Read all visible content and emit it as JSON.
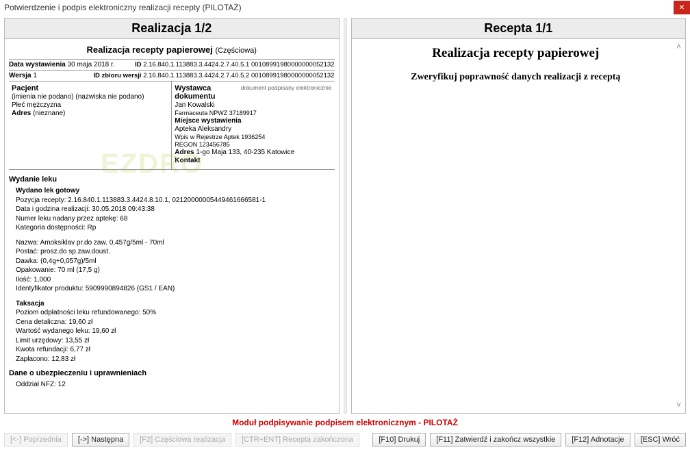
{
  "window": {
    "title": "Potwierdzenie i podpis elektroniczny realizacji recepty (PILOTAŻ)"
  },
  "left": {
    "header": "Realizacja 1/2",
    "subheader": "Realizacja recepty papierowej",
    "subheader_suffix": "(Częściowa)",
    "meta": {
      "date_label": "Data wystawienia",
      "date_value": "30 maja 2018 r.",
      "version_label": "Wersja",
      "version_value": "1",
      "id_label": "ID",
      "id_value": "2.16.840.1.113883.3.4424.2.7.40.5.1 00108991980000000052132",
      "idset_label": "ID zbioru wersji",
      "idset_value": "2.16.840.1.113883.3.4424.2.7.40.5.2 00108991980000000052132"
    },
    "patient": {
      "title": "Pacjent",
      "name": "(imienia nie podano) (nazwiska nie podano)",
      "sex": "Płeć mężczyzna",
      "address_label": "Adres",
      "address_value": "(nieznane)"
    },
    "issuer": {
      "title": "Wystawca dokumentu",
      "sig_note": "dokument podpisany elektronicznie",
      "name": "Jan Kowalski",
      "role": "Farmaceuta NPWZ 37189917",
      "place_label": "Miejsce wystawienia",
      "place_name": "Apteka Aleksandry",
      "reg_entry": "Wpis w Rejestrze Aptek 1936254",
      "regon": "REGON 123456785",
      "address_label": "Adres",
      "address_value": "1-go Maja 133, 40-235 Katowice",
      "contact_label": "Kontakt"
    },
    "dispense": {
      "section": "Wydanie leku",
      "h1": "Wydano lek gotowy",
      "pos": "Pozycja recepty: 2.16.840.1.113883.3.4424.8.10.1, 02120000005449461666581-1",
      "dt": "Data i godzina realizacji: 30.05.2018 09:43:38",
      "num": "Numer leku nadany przez aptekę: 68",
      "cat": "Kategoria dostępności: Rp",
      "name": "Nazwa: Amoksiklav pr.do zaw. 0,457g/5ml - 70ml",
      "form": "Postać: prosz.do sp.zaw.doust.",
      "dose": "Dawka: (0,4g+0,057g)/5ml",
      "pack": "Opakowanie: 70 ml (17,5 g)",
      "qty": "Ilość: 1,000",
      "ident": "Identyfikator produktu: 5909990894826 (GS1 / EAN)",
      "tax_h": "Taksacja",
      "refund": "Poziom odpłatności leku refundowanego: 50%",
      "price": "Cena detaliczna: 19,60 zł",
      "value": "Wartość wydanego leku: 19,60 zł",
      "limit": "Limit urzędowy: 13,55 zł",
      "refund_amt": "Kwota refundacji: 6,77 zł",
      "paid": "Zapłacono: 12,83 zł"
    },
    "insurance": {
      "section": "Dane o ubezpieczeniu i uprawnieniach",
      "nfz": "Oddział NFZ: 12"
    },
    "watermark": "EZDRO"
  },
  "right": {
    "header": "Recepta 1/1",
    "big_title": "Realizacja recepty papierowej",
    "instruction": "Zweryfikuj poprawność danych realizacji z receptą"
  },
  "footer": {
    "pilot": "Moduł podpisywanie podpisem elektronicznym - PILOTAŻ",
    "buttons": {
      "prev": "[<-] Poprzednia",
      "next": "[->] Następna",
      "partial": "[F2] Częściowa realizacja",
      "done": "[CTR+ENT] Recepta zakończona",
      "print": "[F10] Drukuj",
      "confirm": "[F11] Zatwierdź i zakończ wszystkie",
      "annot": "[F12] Adnotacje",
      "back": "[ESC] Wróć"
    }
  }
}
